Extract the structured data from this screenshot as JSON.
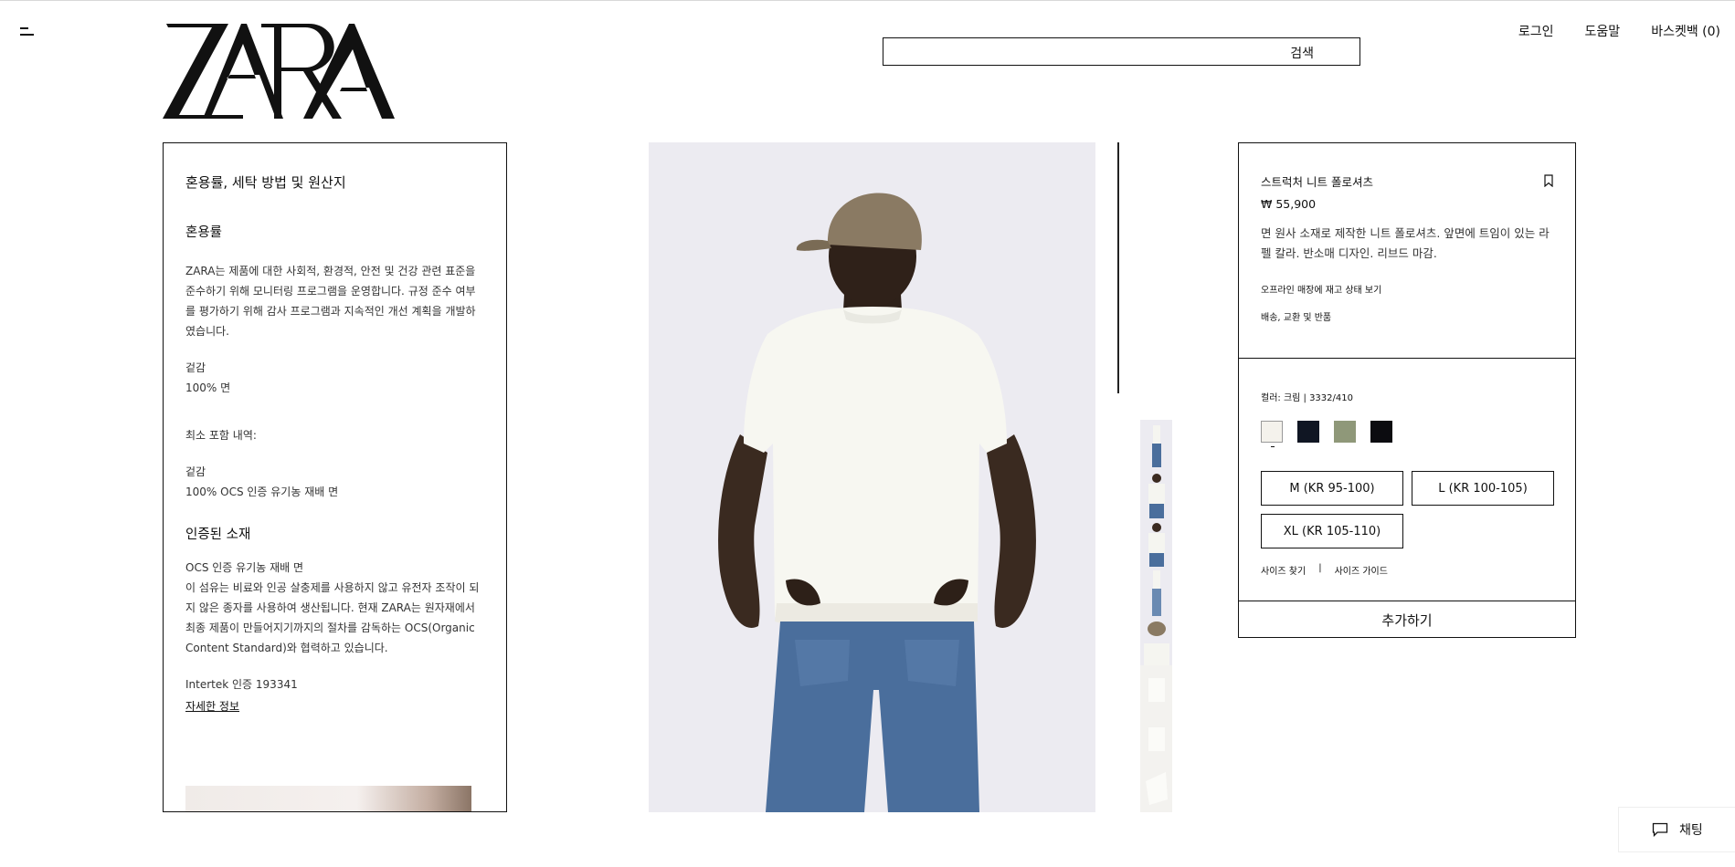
{
  "header": {
    "logo_text": "ZARA",
    "search_label": "검색",
    "search_value": "",
    "nav": {
      "login": "로그인",
      "help": "도움말",
      "cart": "바스켓백 (0)"
    }
  },
  "composition_panel": {
    "title": "혼용률, 세탁 방법 및 원산지",
    "composition_heading": "혼용률",
    "composition_text": "ZARA는 제품에 대한 사회적, 환경적, 안전 및 건강 관련 표준을 준수하기 위해 모니터링 프로그램을 운영합니다. 규정 준수 여부를 평가하기 위해 감사 프로그램과 지속적인 개선 계획을 개발하였습니다.",
    "outer_label": "겉감",
    "outer_value": "100% 면",
    "minimum_content_label": "최소 포함 내역:",
    "outer_label_2": "겉감",
    "outer_value_2": "100% OCS 인증 유기농 재배 면",
    "certified_heading": "인증된 소재",
    "certified_name": "OCS 인증 유기농 재배 면",
    "certified_text": "이 섬유는 비료와 인공 살충제를 사용하지 않고 유전자 조작이 되지 않은 종자를 사용하여 생산됩니다. 현재 ZARA는 원자재에서 최종 제품이 만들어지기까지의 절차를 감독하는 OCS(Organic Content Standard)와 협력하고 있습니다.",
    "certification": "Intertek 인증 193341",
    "more_info": "자세한 정보"
  },
  "product": {
    "name": "스트럭처 니트 폴로셔츠",
    "price": "₩ 55,900",
    "description": "면 원사 소재로 제작한 니트 폴로셔츠. 앞면에 트임이 있는 라펠 칼라. 반소매 디자인. 리브드 마감.",
    "store_stock_link": "오프라인 매장에 재고 상태 보기",
    "shipping_link": "배송, 교환 및 반품",
    "color_label": "컬러: 크림 | 3332/410",
    "colors": [
      "#f4f2ec",
      "#101623",
      "#8f9879",
      "#0c0c10"
    ],
    "selected_color_index": 0,
    "sizes": [
      "M (KR 95-100)",
      "L (KR 100-105)",
      "XL (KR 105-110)"
    ],
    "find_size": "사이즈 찾기",
    "separator": "|",
    "size_guide": "사이즈 가이드",
    "add_button": "추가하기"
  },
  "thumbnails": {
    "count": 8,
    "selected_index": 2
  },
  "chat": {
    "label": "채팅"
  }
}
